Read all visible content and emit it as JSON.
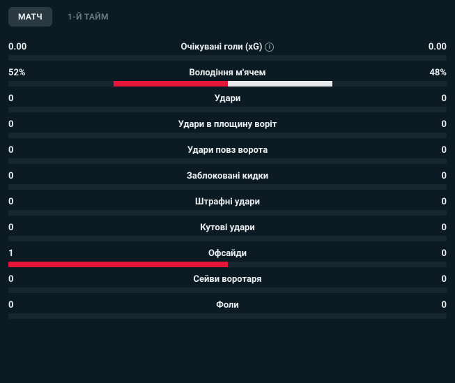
{
  "tabs": [
    {
      "label": "МАТЧ",
      "active": true
    },
    {
      "label": "1-Й ТАЙМ",
      "active": false
    }
  ],
  "stats": [
    {
      "label": "Очікувані голи (xG)",
      "info": true,
      "left": "0.00",
      "right": "0.00",
      "leftPct": 0,
      "rightPct": 0
    },
    {
      "label": "Володіння м'ячем",
      "info": false,
      "left": "52%",
      "right": "48%",
      "leftPct": 26,
      "rightPct": 24,
      "center": true
    },
    {
      "label": "Удари",
      "info": false,
      "left": "0",
      "right": "0",
      "leftPct": 0,
      "rightPct": 0
    },
    {
      "label": "Удари в площину воріт",
      "info": false,
      "left": "0",
      "right": "0",
      "leftPct": 0,
      "rightPct": 0
    },
    {
      "label": "Удари повз ворота",
      "info": false,
      "left": "0",
      "right": "0",
      "leftPct": 0,
      "rightPct": 0
    },
    {
      "label": "Заблоковані кидки",
      "info": false,
      "left": "0",
      "right": "0",
      "leftPct": 0,
      "rightPct": 0
    },
    {
      "label": "Штрафні удари",
      "info": false,
      "left": "0",
      "right": "0",
      "leftPct": 0,
      "rightPct": 0
    },
    {
      "label": "Кутові удари",
      "info": false,
      "left": "0",
      "right": "0",
      "leftPct": 0,
      "rightPct": 0
    },
    {
      "label": "Офсайди",
      "info": false,
      "left": "1",
      "right": "0",
      "leftPct": 50,
      "rightPct": 0
    },
    {
      "label": "Сейви воротаря",
      "info": false,
      "left": "0",
      "right": "0",
      "leftPct": 0,
      "rightPct": 0
    },
    {
      "label": "Фоли",
      "info": false,
      "left": "0",
      "right": "0",
      "leftPct": 0,
      "rightPct": 0
    }
  ]
}
